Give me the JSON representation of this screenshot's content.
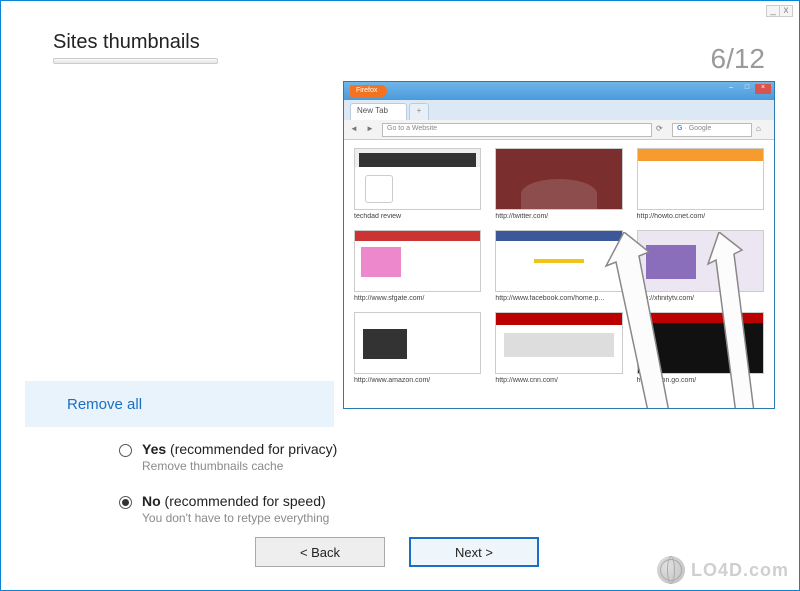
{
  "window": {
    "minimize": "_",
    "close": "x"
  },
  "heading": "Sites thumbnails",
  "step": "6/12",
  "preview": {
    "browser_name": "Firefox",
    "tab_label": "New Tab",
    "plus_label": "+",
    "url_placeholder": "Go to a Website",
    "search_placeholder": "Google",
    "menu_glyph": "≡",
    "thumbs": [
      {
        "label": "techdad review"
      },
      {
        "label": "http://twitter.com/"
      },
      {
        "label": "http://howto.cnet.com/"
      },
      {
        "label": "http://www.sfgate.com/"
      },
      {
        "label": "http://www.facebook.com/home.p..."
      },
      {
        "label": "http://xfinitytv.com/"
      },
      {
        "label": "http://www.amazon.com/"
      },
      {
        "label": "http://www.cnn.com/"
      },
      {
        "label": "http://espn.go.com/"
      }
    ]
  },
  "question": "Remove all",
  "options": {
    "yes": {
      "bold": "Yes",
      "rest": " (recommended for privacy)",
      "sub": "Remove thumbnails cache",
      "selected": false
    },
    "no": {
      "bold": "No",
      "rest": " (recommended for speed)",
      "sub": "You don't have to retype everything",
      "selected": true
    }
  },
  "buttons": {
    "back": "< Back",
    "next": "Next >"
  },
  "watermark": "LO4D.com"
}
